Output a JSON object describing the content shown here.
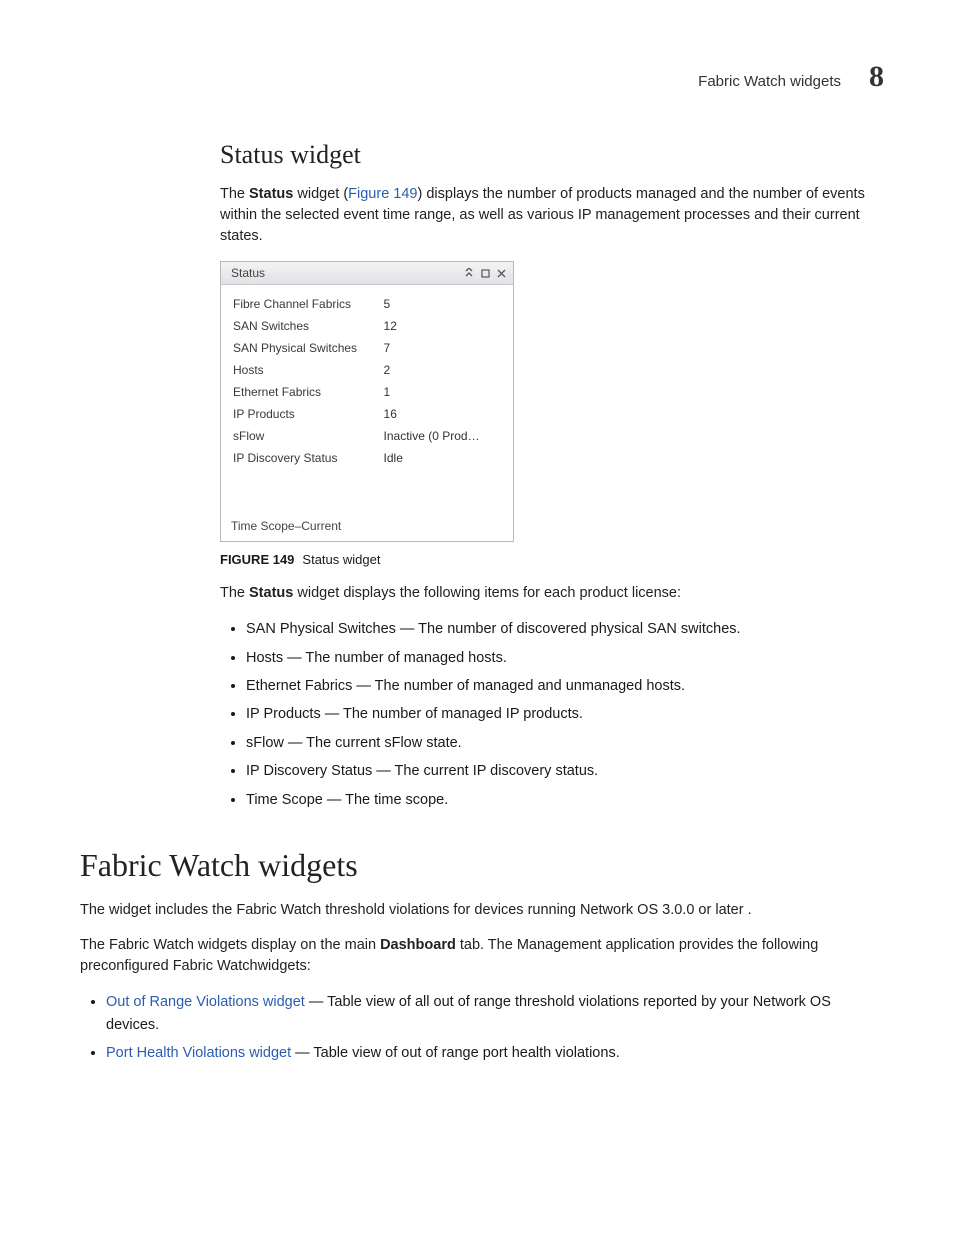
{
  "header": {
    "running_title": "Fabric Watch widgets",
    "chapter_number": "8"
  },
  "status_section": {
    "heading": "Status widget",
    "intro_pre": "The ",
    "intro_bold": "Status",
    "intro_mid": " widget (",
    "intro_link": "Figure 149",
    "intro_post": ") displays the number of products managed and the number of events within the selected event time range, as well as various IP management processes and their current states.",
    "figure_caption_label": "FIGURE 149",
    "figure_caption_text": "Status widget",
    "after_fig_pre": "The ",
    "after_fig_bold": "Status",
    "after_fig_post": " widget displays the following items for each product license:",
    "bullets": [
      "SAN Physical Switches — The number of discovered physical SAN switches.",
      "Hosts — The number of managed hosts.",
      "Ethernet Fabrics — The number of managed and unmanaged hosts.",
      "IP Products — The number of managed IP products.",
      "sFlow — The current sFlow state.",
      "IP Discovery Status — The current IP discovery status.",
      "Time Scope — The time scope."
    ]
  },
  "widget": {
    "title": "Status",
    "rows": [
      {
        "label": "Fibre Channel Fabrics",
        "value": "5"
      },
      {
        "label": "SAN Switches",
        "value": "12"
      },
      {
        "label": "SAN Physical Switches",
        "value": "7"
      },
      {
        "label": "Hosts",
        "value": "2"
      },
      {
        "label": "Ethernet Fabrics",
        "value": "1"
      },
      {
        "label": "IP Products",
        "value": "16"
      },
      {
        "label": "sFlow",
        "value": "Inactive (0 Prod…"
      },
      {
        "label": "IP Discovery Status",
        "value": "Idle"
      }
    ],
    "footer": "Time Scope–Current"
  },
  "fabric_section": {
    "heading": "Fabric Watch widgets",
    "p1": "The widget includes the Fabric Watch threshold violations for devices running Network OS 3.0.0 or later .",
    "p2_pre": "The Fabric Watch widgets display on the main ",
    "p2_bold": "Dashboard",
    "p2_post": " tab. The Management application provides the following preconfigured Fabric Watchwidgets:",
    "bullets": [
      {
        "link": "Out of Range Violations widget",
        "rest": " — Table view of all out of range threshold violations reported by your Network OS devices."
      },
      {
        "link": "Port Health Violations widget",
        "rest": " — Table view of out of range port health violations."
      }
    ]
  }
}
